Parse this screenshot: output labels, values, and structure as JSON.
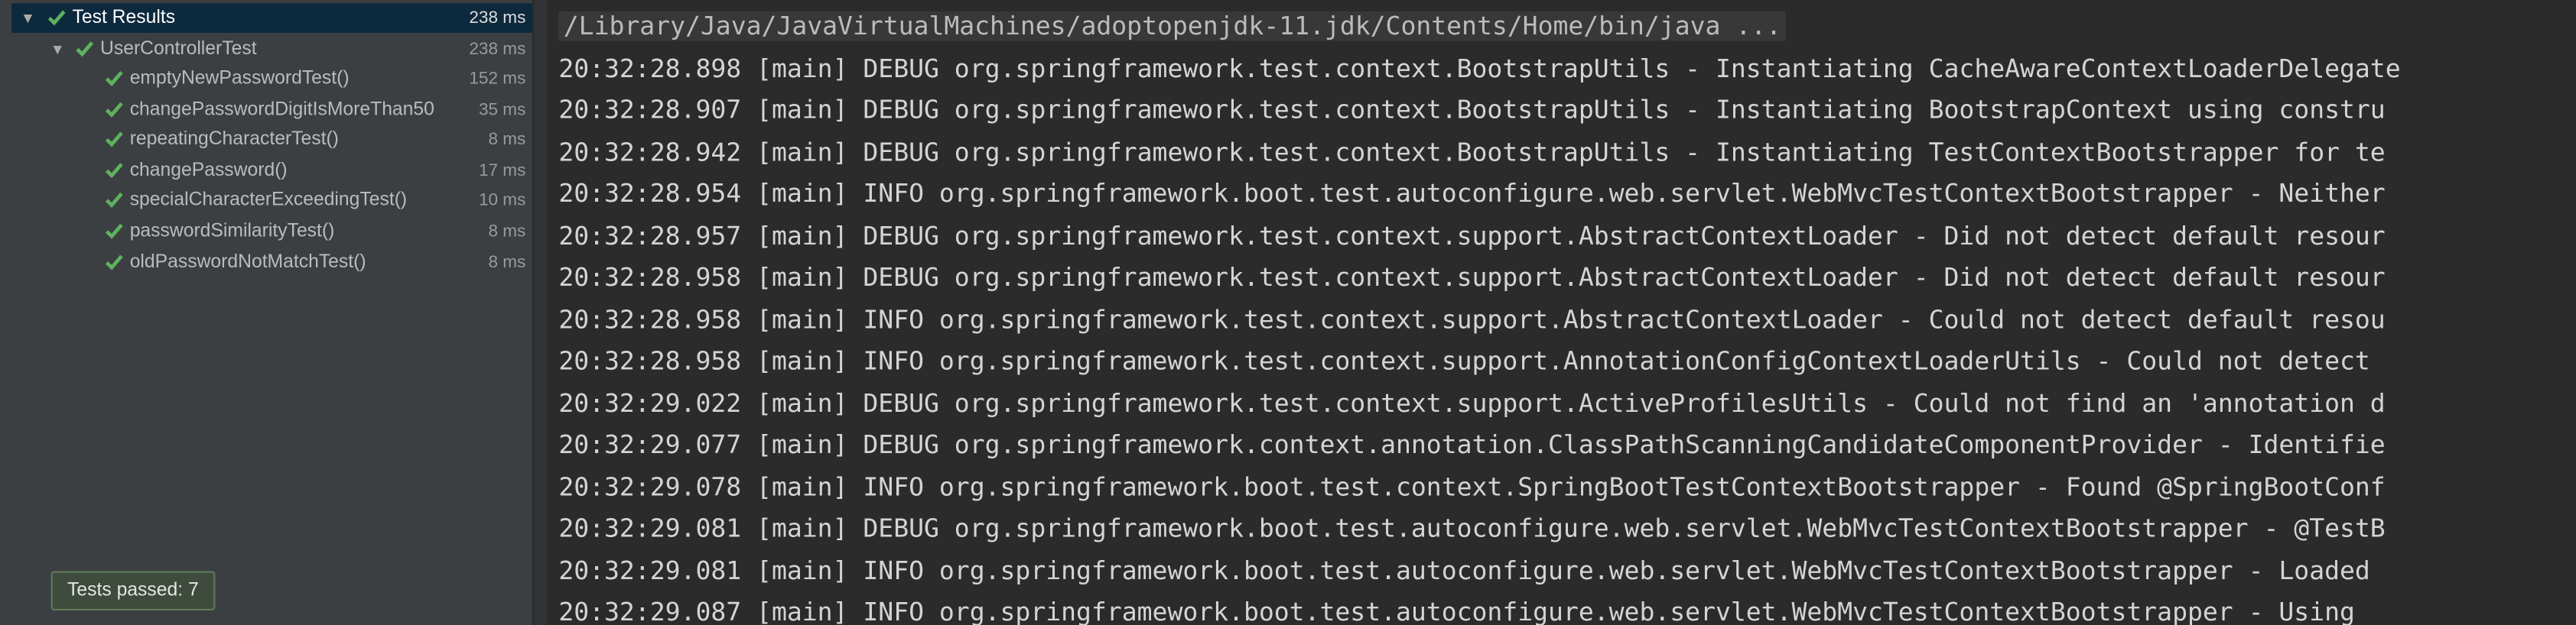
{
  "tree": {
    "root": {
      "label": "Test Results",
      "time": "238 ms"
    },
    "suite": {
      "label": "UserControllerTest",
      "time": "238 ms"
    },
    "tests": [
      {
        "label": "emptyNewPasswordTest()",
        "time": "152 ms"
      },
      {
        "label": "changePasswordDigitIsMoreThan50",
        "time": "35 ms"
      },
      {
        "label": "repeatingCharacterTest()",
        "time": "8 ms"
      },
      {
        "label": "changePassword()",
        "time": "17 ms"
      },
      {
        "label": "specialCharacterExceedingTest()",
        "time": "10 ms"
      },
      {
        "label": "passwordSimilarityTest()",
        "time": "8 ms"
      },
      {
        "label": "oldPasswordNotMatchTest()",
        "time": "8 ms"
      }
    ],
    "status_icon": "check-icon",
    "pass_color": "#5fb15f"
  },
  "tooltip": {
    "text": "Tests passed: 7"
  },
  "console": {
    "command": "/Library/Java/JavaVirtualMachines/adoptopenjdk-11.jdk/Contents/Home/bin/java ...",
    "lines": [
      "20:32:28.898 [main] DEBUG org.springframework.test.context.BootstrapUtils - Instantiating CacheAwareContextLoaderDelegate",
      "20:32:28.907 [main] DEBUG org.springframework.test.context.BootstrapUtils - Instantiating BootstrapContext using constru",
      "20:32:28.942 [main] DEBUG org.springframework.test.context.BootstrapUtils - Instantiating TestContextBootstrapper for te",
      "20:32:28.954 [main] INFO org.springframework.boot.test.autoconfigure.web.servlet.WebMvcTestContextBootstrapper - Neither",
      "20:32:28.957 [main] DEBUG org.springframework.test.context.support.AbstractContextLoader - Did not detect default resour",
      "20:32:28.958 [main] DEBUG org.springframework.test.context.support.AbstractContextLoader - Did not detect default resour",
      "20:32:28.958 [main] INFO org.springframework.test.context.support.AbstractContextLoader - Could not detect default resou",
      "20:32:28.958 [main] INFO org.springframework.test.context.support.AnnotationConfigContextLoaderUtils - Could not detect",
      "20:32:29.022 [main] DEBUG org.springframework.test.context.support.ActiveProfilesUtils - Could not find an 'annotation d",
      "20:32:29.077 [main] DEBUG org.springframework.context.annotation.ClassPathScanningCandidateComponentProvider - Identifie",
      "20:32:29.078 [main] INFO org.springframework.boot.test.context.SpringBootTestContextBootstrapper - Found @SpringBootConf",
      "20:32:29.081 [main] DEBUG org.springframework.boot.test.autoconfigure.web.servlet.WebMvcTestContextBootstrapper - @TestB",
      "20:32:29.081 [main] INFO org.springframework.boot.test.autoconfigure.web.servlet.WebMvcTestContextBootstrapper - Loaded",
      "20:32:29.087 [main] INFO org.springframework.boot.test.autoconfigure.web.servlet.WebMvcTestContextBootstrapper - Using"
    ]
  }
}
